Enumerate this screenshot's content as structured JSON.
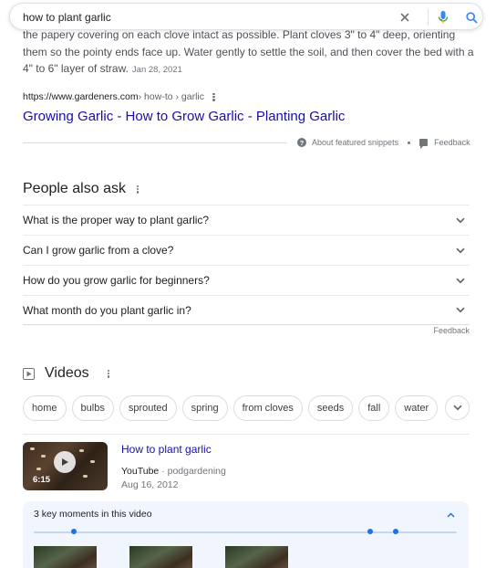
{
  "search": {
    "query": "how to plant garlic",
    "clear_icon": "close-icon",
    "voice_icon": "microphone-icon",
    "search_icon": "search-icon"
  },
  "snippet": {
    "text": "the papery covering on each clove intact as possible. Plant cloves 3\" to 4\" deep, orienting them so the pointy ends face up. Water gently to settle the soil, and then cover the bed with a 4\" to 6\" layer of straw.",
    "date": "Jan 28, 2021",
    "source_domain": "https://www.gardeners.com",
    "source_path": " › how-to › garlic",
    "title": "Growing Garlic - How to Grow Garlic - Planting Garlic",
    "about_label": "About featured snippets",
    "feedback_label": "Feedback"
  },
  "people_also_ask": {
    "title": "People also ask",
    "questions": [
      "What is the proper way to plant garlic?",
      "Can I grow garlic from a clove?",
      "How do you grow garlic for beginners?",
      "What month do you plant garlic in?"
    ],
    "feedback_label": "Feedback"
  },
  "videos": {
    "title": "Videos",
    "chips": [
      "home",
      "bulbs",
      "sprouted",
      "spring",
      "from cloves",
      "seeds",
      "fall",
      "water"
    ],
    "item": {
      "title": "How to plant garlic",
      "source": "YouTube",
      "channel": "podgardening",
      "date": "Aug 16, 2012",
      "duration": "6:15"
    },
    "key_moments": {
      "label": "3 key moments in this video"
    }
  },
  "colors": {
    "link": "#1a0dab",
    "accent": "#1a73e8",
    "text": "#202124",
    "muted": "#70757a"
  }
}
